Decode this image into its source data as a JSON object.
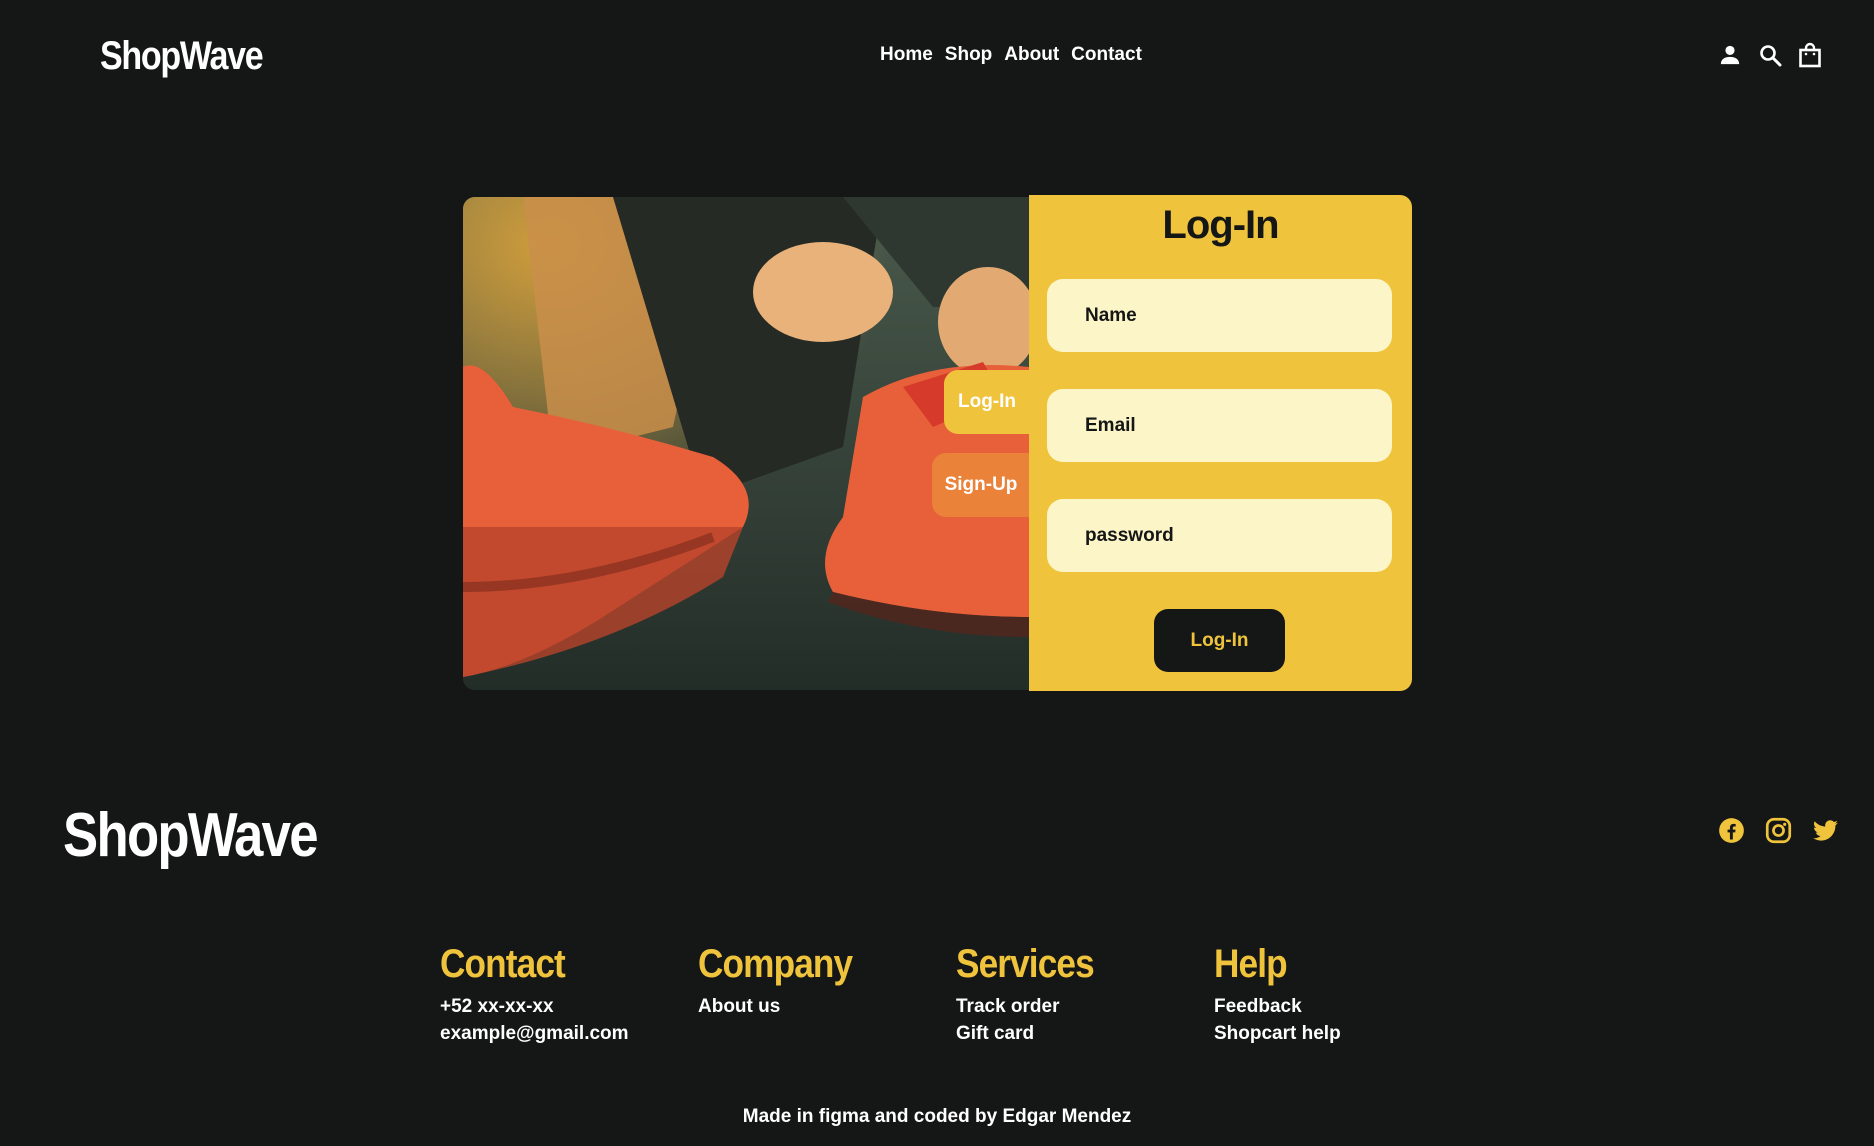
{
  "header": {
    "brand": "ShopWave",
    "nav": [
      "Home",
      "Shop",
      "About",
      "Contact"
    ],
    "icons": [
      "user-icon",
      "search-icon",
      "shopping-bag-icon"
    ]
  },
  "login": {
    "title": "Log-In",
    "tabs": {
      "login": "Log-In",
      "signup": "Sign-Up"
    },
    "fields": {
      "name_placeholder": "Name",
      "email_placeholder": "Email",
      "password_placeholder": "password"
    },
    "submit_label": "Log-In",
    "image": "running-shoes-lacing-photo"
  },
  "footer": {
    "brand": "ShopWave",
    "social": [
      "facebook-icon",
      "instagram-icon",
      "twitter-icon"
    ],
    "columns": [
      {
        "title": "Contact",
        "links": [
          "+52 xx-xx-xx",
          "example@gmail.com"
        ]
      },
      {
        "title": "Company",
        "links": [
          "About us"
        ]
      },
      {
        "title": "Services",
        "links": [
          "Track order",
          "Gift card"
        ]
      },
      {
        "title": "Help",
        "links": [
          "Feedback",
          "Shopcart help"
        ]
      }
    ],
    "credit": "Made in figma and coded by Edgar Mendez"
  },
  "colors": {
    "background": "#151616",
    "accent": "#efc43c",
    "field": "#fcf5c8",
    "text": "#ffffff"
  }
}
